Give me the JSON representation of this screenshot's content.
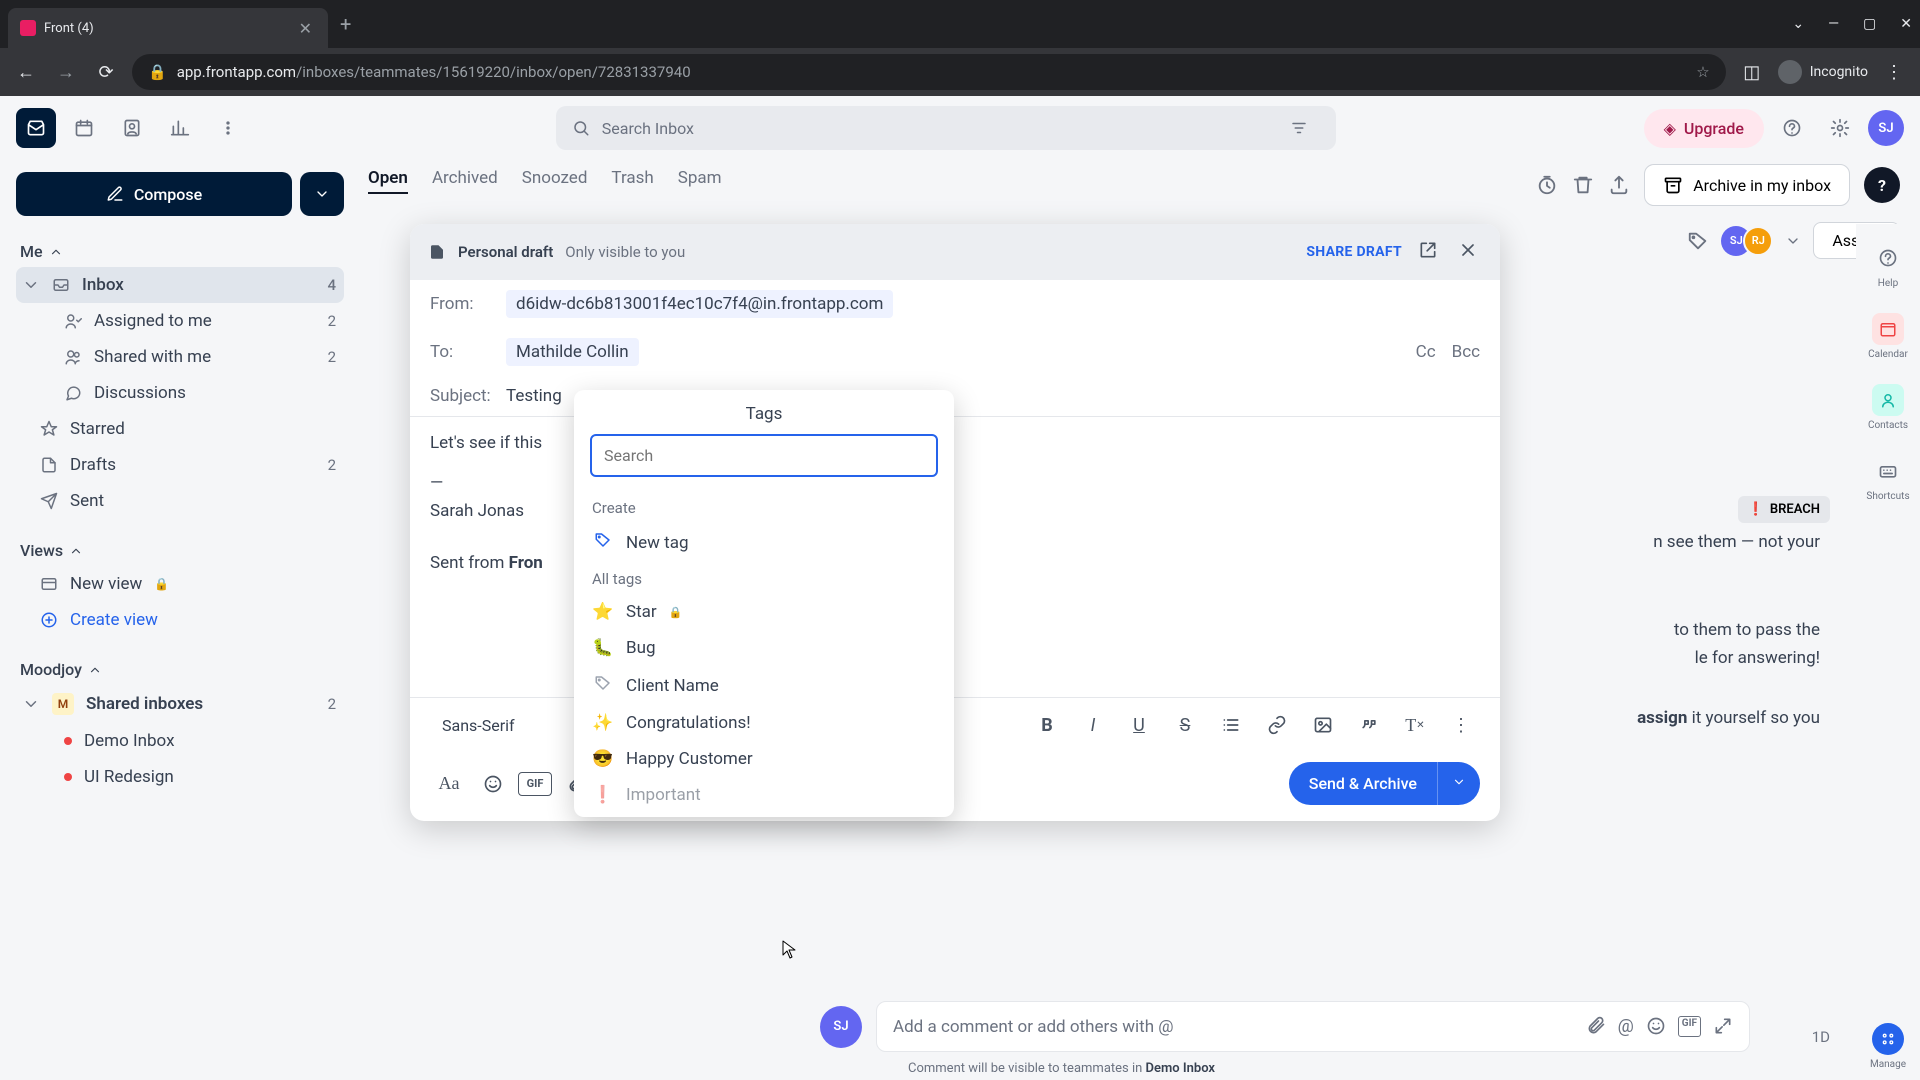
{
  "browser": {
    "tab_title": "Front (4)",
    "url_host": "app.frontapp.com",
    "url_path": "/inboxes/teammates/15619220/inbox/open/72831337940",
    "incognito_label": "Incognito"
  },
  "header": {
    "search_placeholder": "Search Inbox",
    "upgrade_label": "Upgrade",
    "avatar_initials": "SJ"
  },
  "sidebar": {
    "compose_label": "Compose",
    "me_label": "Me",
    "items": [
      {
        "label": "Inbox",
        "count": "4",
        "icon": "inbox"
      },
      {
        "label": "Assigned to me",
        "count": "2",
        "icon": "user-check"
      },
      {
        "label": "Shared with me",
        "count": "2",
        "icon": "users"
      },
      {
        "label": "Discussions",
        "count": "",
        "icon": "chat"
      },
      {
        "label": "Starred",
        "count": "",
        "icon": "star"
      },
      {
        "label": "Drafts",
        "count": "2",
        "icon": "file"
      },
      {
        "label": "Sent",
        "count": "",
        "icon": "send"
      }
    ],
    "views_label": "Views",
    "new_view_label": "New view",
    "create_view_label": "Create view",
    "moodjoy_label": "Moodjoy",
    "shared_inboxes_label": "Shared inboxes",
    "shared_count": "2",
    "shared_items": [
      {
        "label": "Demo Inbox",
        "color": "#ef4444"
      },
      {
        "label": "UI Redesign",
        "color": "#ef4444"
      }
    ]
  },
  "tabs": [
    "Open",
    "Archived",
    "Snoozed",
    "Trash",
    "Spam"
  ],
  "actions": {
    "archive_label": "Archive in my inbox",
    "breach_tag": "BREACH",
    "assign_label": "Assign",
    "avatars": [
      "SJ",
      "RJ"
    ]
  },
  "compose": {
    "draft_badge": "Personal draft",
    "visibility": "Only visible to you",
    "share_label": "SHARE DRAFT",
    "from_label": "From:",
    "from_value": "d6idw-dc6b813001f4ec10c7f4@in.frontapp.com",
    "to_label": "To:",
    "to_value": "Mathilde Collin",
    "cc_label": "Cc",
    "bcc_label": "Bcc",
    "subject_label": "Subject:",
    "subject_value": "Testing",
    "body_line": "Let's see if this",
    "signature_name": "Sarah Jonas",
    "sent_from_prefix": "Sent from ",
    "sent_from_brand": "Fron",
    "font_value": "Sans-Serif",
    "send_label": "Send & Archive"
  },
  "tags_popover": {
    "title": "Tags",
    "search_placeholder": "Search",
    "create_label": "Create",
    "new_tag_label": "New tag",
    "all_tags_label": "All tags",
    "tags": [
      {
        "icon": "⭐",
        "label": "Star",
        "locked": true
      },
      {
        "icon": "🐛",
        "label": "Bug"
      },
      {
        "iconType": "tag",
        "label": "Client Name"
      },
      {
        "icon": "✨",
        "label": "Congratulations!"
      },
      {
        "icon": "😎",
        "label": "Happy Customer"
      },
      {
        "icon": "❗",
        "label": "Important"
      }
    ]
  },
  "rail": {
    "items": [
      {
        "label": "Help",
        "color": "#6b7280"
      },
      {
        "label": "Calendar",
        "color": "#ef4444"
      },
      {
        "label": "Contacts",
        "color": "#14b8a6"
      },
      {
        "label": "Shortcuts",
        "color": "#6b7280"
      }
    ],
    "manage_label": "Manage"
  },
  "background_fragments": {
    "frag1": "to them to pass the",
    "frag2": "le for answering!",
    "frag3_prefix": "assign",
    "frag3_rest": " it yourself so you",
    "frag4": "n see them — not your"
  },
  "comment": {
    "avatar": "SJ",
    "placeholder": "Add a comment or add others with @",
    "note_prefix": "Comment will be visible to teammates in ",
    "note_bold": "Demo Inbox"
  },
  "time_badge": "1D"
}
